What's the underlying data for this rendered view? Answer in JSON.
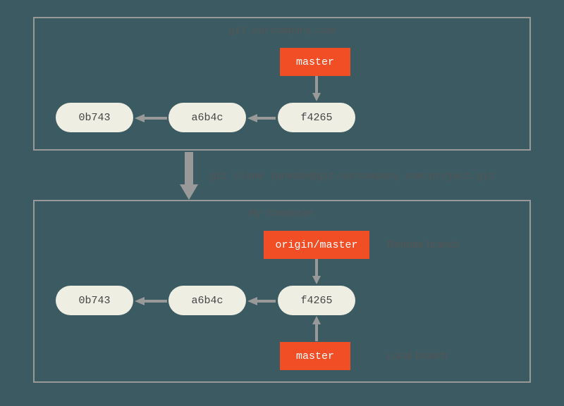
{
  "remote": {
    "title": "git.ourcompany.com",
    "commits": [
      "0b743",
      "a6b4c",
      "f4265"
    ],
    "branch": "master"
  },
  "cloneCommand": "git clone janedoe@git.ourcompany.com:project.git",
  "local": {
    "title": "My Computer",
    "commits": [
      "0b743",
      "a6b4c",
      "f4265"
    ],
    "originBranch": "origin/master",
    "originLabel": "Remote branch",
    "localBranch": "master",
    "localLabel": "Local branch"
  },
  "colors": {
    "background": "#3b5a62",
    "commit": "#efeee3",
    "branch": "#f14e26",
    "arrow": "#999999"
  }
}
